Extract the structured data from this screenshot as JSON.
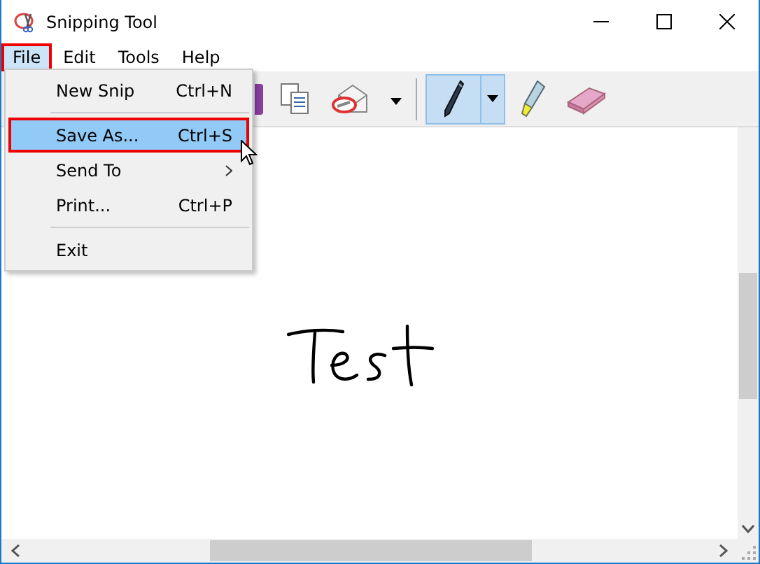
{
  "window": {
    "title": "Snipping Tool"
  },
  "menu_bar": [
    {
      "label": "File",
      "selected": true
    },
    {
      "label": "Edit",
      "selected": false
    },
    {
      "label": "Tools",
      "selected": false
    },
    {
      "label": "Help",
      "selected": false
    }
  ],
  "toolbar": [
    {
      "kind": "copy",
      "selected": false
    },
    {
      "kind": "email",
      "selected": false
    },
    {
      "kind": "pen",
      "selected": true
    },
    {
      "kind": "highlighter",
      "selected": false
    },
    {
      "kind": "eraser",
      "selected": false
    }
  ],
  "file_menu": [
    {
      "kind": "item",
      "label": "New Snip",
      "shortcut": "Ctrl+N",
      "selected": false
    },
    {
      "kind": "separator"
    },
    {
      "kind": "item",
      "label": "Save As...",
      "shortcut": "Ctrl+S",
      "selected": true
    },
    {
      "kind": "submenu",
      "label": "Send To",
      "selected": false
    },
    {
      "kind": "item",
      "label": "Print...",
      "shortcut": "Ctrl+P",
      "selected": false
    },
    {
      "kind": "separator"
    },
    {
      "kind": "item",
      "label": "Exit",
      "selected": false
    }
  ]
}
